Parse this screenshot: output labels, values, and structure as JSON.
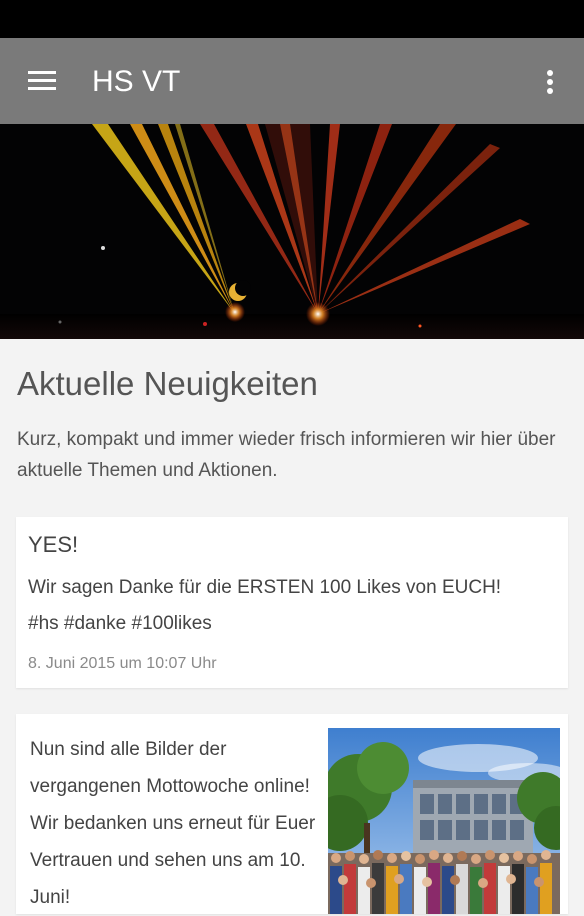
{
  "app_bar": {
    "title": "HS VT",
    "menu_icon": "hamburger-menu-icon",
    "overflow_icon": "more-vert-icon",
    "background": "#7a7a7a"
  },
  "hero": {
    "image": "laser-show-banner"
  },
  "intro": {
    "title": "Aktuelle Neuigkeiten",
    "description": "Kurz, kompakt und immer wieder frisch informieren wir hier über aktuelle Themen und Aktionen."
  },
  "posts": [
    {
      "title": "YES!",
      "body_line1": "Wir sagen Danke für die ERSTEN 100 Likes von EUCH!",
      "body_line2": "#hs #danke #100likes",
      "date": "8. Juni 2015 um 10:07 Uhr"
    },
    {
      "body": "Nun sind alle Bilder der vergangenen Mottowoche online! Wir bedanken uns erneut für Euer Vertrauen und sehen uns am 10. Juni!",
      "image": "school-group-photo"
    }
  ]
}
